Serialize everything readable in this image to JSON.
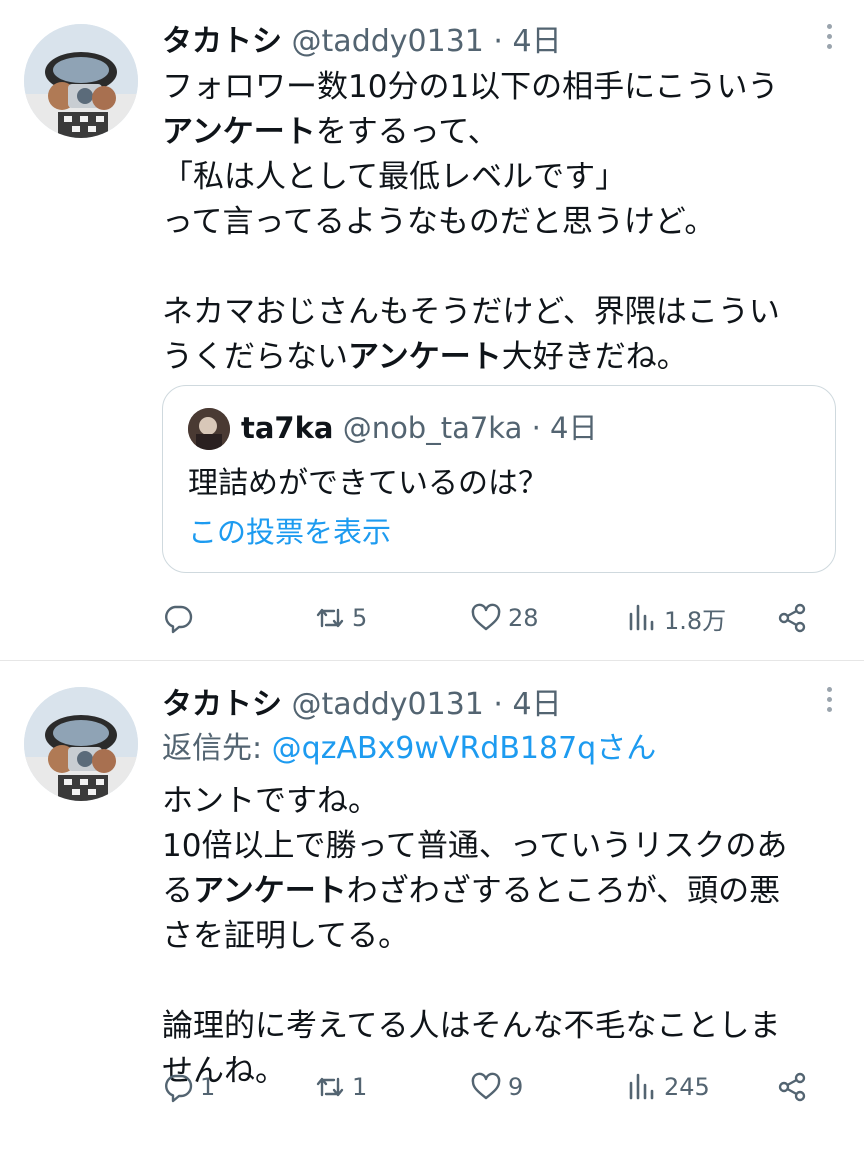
{
  "tweets": [
    {
      "author": {
        "name": "タカトシ",
        "handle": "@taddy0131",
        "time": "4日"
      },
      "body": [
        {
          "text": "フォロワー数10分の1以下の相手にこういう\n"
        },
        {
          "text": "アンケート",
          "bold": true
        },
        {
          "text": "をするって、\n「私は人として最低レベルです」\nって言ってるようなものだと思うけど。\n\nネカマおじさんもそうだけど、界隈はこうい\nうくだらない"
        },
        {
          "text": "アンケート",
          "bold": true
        },
        {
          "text": "大好きだね。"
        }
      ],
      "quote": {
        "name": "ta7ka",
        "handle": "@nob_ta7ka",
        "time": "4日",
        "text": "理詰めができているのは？",
        "link": "この投票を表示"
      },
      "actions": {
        "replies": "",
        "retweets": "5",
        "likes": "28",
        "views": "1.8万"
      }
    },
    {
      "author": {
        "name": "タカトシ",
        "handle": "@taddy0131",
        "time": "4日"
      },
      "reply_to_label": "返信先: ",
      "reply_to_mention": "@qzABx9wVRdB187qさん",
      "body": [
        {
          "text": "ホントですね。\n10倍以上で勝って普通、っていうリスクのあ\nる"
        },
        {
          "text": "アンケート",
          "bold": true
        },
        {
          "text": "わざわざするところが、頭の悪\nさを証明してる。\n\n論理的に考えてる人はそんな不毛なことしま\nせんね。"
        }
      ],
      "actions": {
        "replies": "1",
        "retweets": "1",
        "likes": "9",
        "views": "245"
      }
    }
  ],
  "colors": {
    "text": "#0f1419",
    "secondary": "#536471",
    "accent": "#1d9bf0",
    "border": "#cfd9de"
  },
  "icons": [
    "reply-icon",
    "retweet-icon",
    "like-icon",
    "views-icon",
    "share-icon",
    "more-icon"
  ]
}
